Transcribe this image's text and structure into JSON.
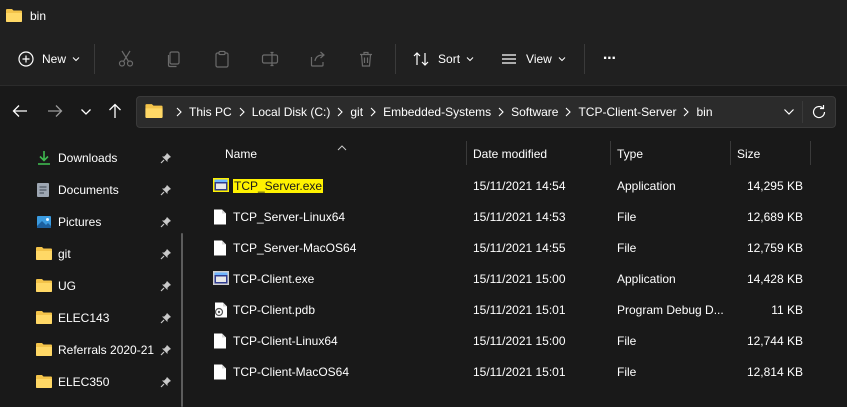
{
  "window": {
    "title": "bin"
  },
  "toolbar": {
    "new_label": "New",
    "sort_label": "Sort",
    "view_label": "View",
    "more_label": "···"
  },
  "address": {
    "crumbs": [
      "This PC",
      "Local Disk (C:)",
      "git",
      "Embedded-Systems",
      "Software",
      "TCP-Client-Server",
      "bin"
    ]
  },
  "sidebar": {
    "items": [
      {
        "label": "Downloads",
        "icon": "download-icon"
      },
      {
        "label": "Documents",
        "icon": "documents-icon"
      },
      {
        "label": "Pictures",
        "icon": "pictures-icon"
      },
      {
        "label": "git",
        "icon": "folder-icon"
      },
      {
        "label": "UG",
        "icon": "folder-icon"
      },
      {
        "label": "ELEC143",
        "icon": "folder-icon"
      },
      {
        "label": "Referrals 2020-21",
        "icon": "folder-icon"
      },
      {
        "label": "ELEC350",
        "icon": "folder-icon"
      }
    ]
  },
  "columns": {
    "name": "Name",
    "date": "Date modified",
    "type": "Type",
    "size": "Size"
  },
  "files": [
    {
      "name": "TCP_Server.exe",
      "date": "15/11/2021 14:54",
      "type": "Application",
      "size": "14,295 KB",
      "icon": "app-icon"
    },
    {
      "name": "TCP_Server-Linux64",
      "date": "15/11/2021 14:53",
      "type": "File",
      "size": "12,689 KB",
      "icon": "file-icon"
    },
    {
      "name": "TCP_Server-MacOS64",
      "date": "15/11/2021 14:55",
      "type": "File",
      "size": "12,759 KB",
      "icon": "file-icon"
    },
    {
      "name": "TCP-Client.exe",
      "date": "15/11/2021 15:00",
      "type": "Application",
      "size": "14,428 KB",
      "icon": "app-icon"
    },
    {
      "name": "TCP-Client.pdb",
      "date": "15/11/2021 15:01",
      "type": "Program Debug D...",
      "size": "11 KB",
      "icon": "pdb-icon"
    },
    {
      "name": "TCP-Client-Linux64",
      "date": "15/11/2021 15:00",
      "type": "File",
      "size": "12,744 KB",
      "icon": "file-icon"
    },
    {
      "name": "TCP-Client-MacOS64",
      "date": "15/11/2021 15:01",
      "type": "File",
      "size": "12,814 KB",
      "icon": "file-icon"
    }
  ],
  "colors": {
    "background": "#191919",
    "chrome": "#202020",
    "folder": "#f3c34a",
    "highlight": "#fff200"
  }
}
